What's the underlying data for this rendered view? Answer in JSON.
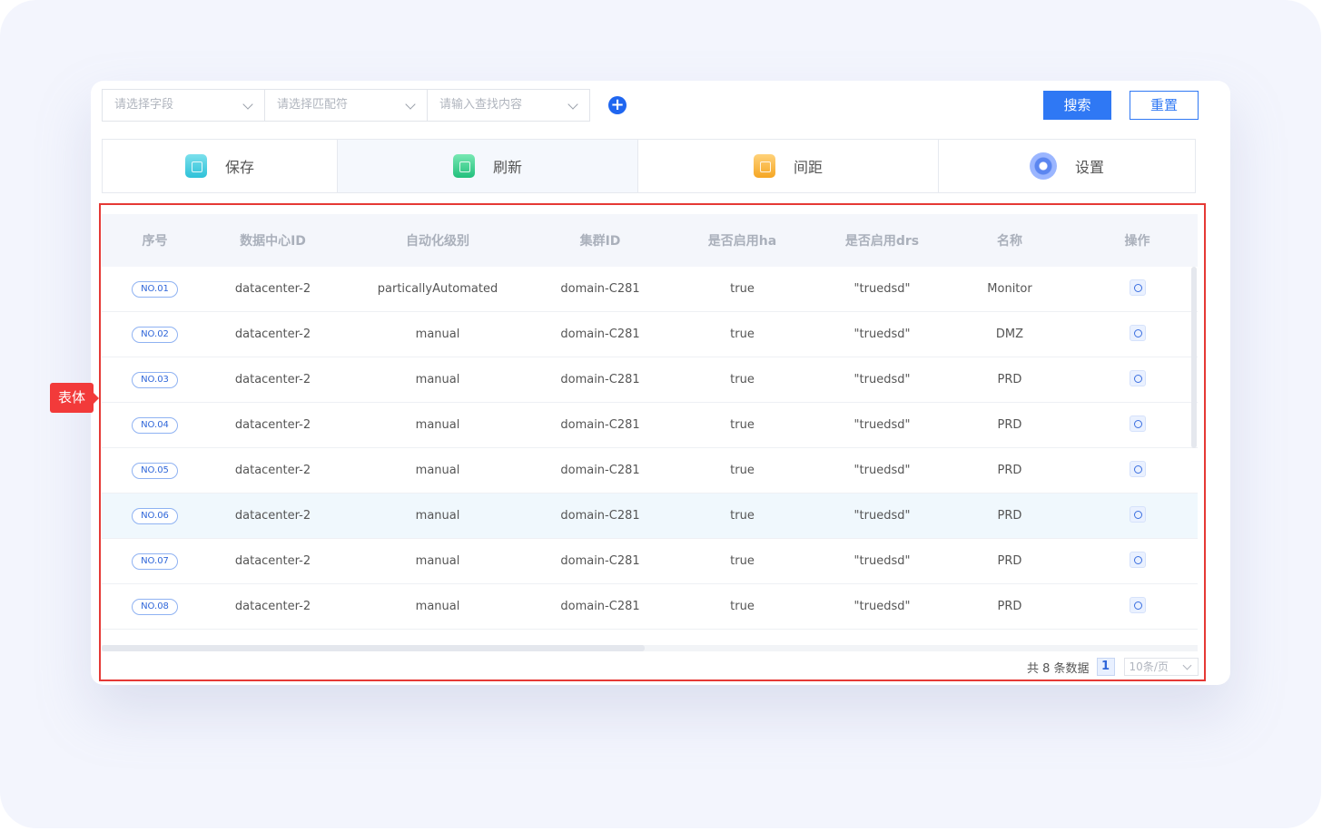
{
  "filters": {
    "field_placeholder": "请选择字段",
    "match_placeholder": "请选择匹配符",
    "content_placeholder": "请输入查找内容",
    "add_symbol": "+"
  },
  "buttons": {
    "search": "搜索",
    "reset": "重置"
  },
  "tabs": [
    {
      "label": "保存",
      "icon": "save-icon"
    },
    {
      "label": "刷新",
      "icon": "refresh-icon"
    },
    {
      "label": "间距",
      "icon": "spacing-icon"
    },
    {
      "label": "设置",
      "icon": "gear-icon"
    }
  ],
  "annotation": {
    "label": "表体"
  },
  "table": {
    "headers": [
      "序号",
      "数据中心ID",
      "自动化级别",
      "集群ID",
      "是否启用ha",
      "是否启用drs",
      "名称",
      "操作"
    ],
    "rows": [
      {
        "no": "NO.01",
        "dc": "datacenter-2",
        "level": "particallyAutomated",
        "cluster": "domain-C281",
        "ha": "true",
        "drs": "\"truedsd\"",
        "name": "Monitor"
      },
      {
        "no": "NO.02",
        "dc": "datacenter-2",
        "level": "manual",
        "cluster": "domain-C281",
        "ha": "true",
        "drs": "\"truedsd\"",
        "name": "DMZ"
      },
      {
        "no": "NO.03",
        "dc": "datacenter-2",
        "level": "manual",
        "cluster": "domain-C281",
        "ha": "true",
        "drs": "\"truedsd\"",
        "name": "PRD"
      },
      {
        "no": "NO.04",
        "dc": "datacenter-2",
        "level": "manual",
        "cluster": "domain-C281",
        "ha": "true",
        "drs": "\"truedsd\"",
        "name": "PRD"
      },
      {
        "no": "NO.05",
        "dc": "datacenter-2",
        "level": "manual",
        "cluster": "domain-C281",
        "ha": "true",
        "drs": "\"truedsd\"",
        "name": "PRD"
      },
      {
        "no": "NO.06",
        "dc": "datacenter-2",
        "level": "manual",
        "cluster": "domain-C281",
        "ha": "true",
        "drs": "\"truedsd\"",
        "name": "PRD"
      },
      {
        "no": "NO.07",
        "dc": "datacenter-2",
        "level": "manual",
        "cluster": "domain-C281",
        "ha": "true",
        "drs": "\"truedsd\"",
        "name": "PRD"
      },
      {
        "no": "NO.08",
        "dc": "datacenter-2",
        "level": "manual",
        "cluster": "domain-C281",
        "ha": "true",
        "drs": "\"truedsd\"",
        "name": "PRD"
      }
    ]
  },
  "pagination": {
    "total_text": "共 8 条数据",
    "current_page": "1",
    "page_size": "10条/页"
  },
  "colors": {
    "accent": "#2f78f4",
    "annotation": "#f23a3a",
    "highlight_row": "#f0f8fd"
  }
}
